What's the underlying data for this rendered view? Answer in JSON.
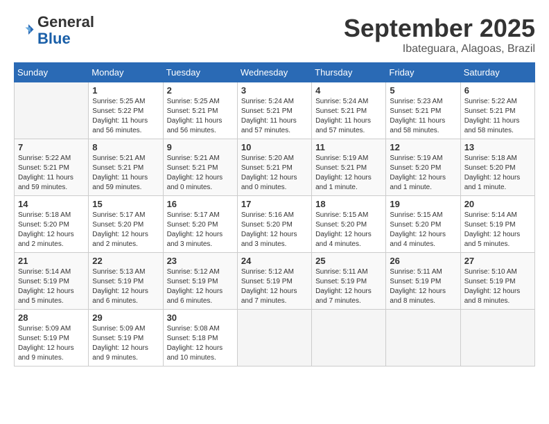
{
  "logo": {
    "text_general": "General",
    "text_blue": "Blue"
  },
  "title": "September 2025",
  "subtitle": "Ibateguara, Alagoas, Brazil",
  "weekdays": [
    "Sunday",
    "Monday",
    "Tuesday",
    "Wednesday",
    "Thursday",
    "Friday",
    "Saturday"
  ],
  "weeks": [
    [
      {
        "day": "",
        "empty": true
      },
      {
        "day": "1",
        "sunrise": "5:25 AM",
        "sunset": "5:22 PM",
        "daylight": "11 hours and 56 minutes."
      },
      {
        "day": "2",
        "sunrise": "5:25 AM",
        "sunset": "5:21 PM",
        "daylight": "11 hours and 56 minutes."
      },
      {
        "day": "3",
        "sunrise": "5:24 AM",
        "sunset": "5:21 PM",
        "daylight": "11 hours and 57 minutes."
      },
      {
        "day": "4",
        "sunrise": "5:24 AM",
        "sunset": "5:21 PM",
        "daylight": "11 hours and 57 minutes."
      },
      {
        "day": "5",
        "sunrise": "5:23 AM",
        "sunset": "5:21 PM",
        "daylight": "11 hours and 58 minutes."
      },
      {
        "day": "6",
        "sunrise": "5:22 AM",
        "sunset": "5:21 PM",
        "daylight": "11 hours and 58 minutes."
      }
    ],
    [
      {
        "day": "7",
        "sunrise": "5:22 AM",
        "sunset": "5:21 PM",
        "daylight": "11 hours and 59 minutes."
      },
      {
        "day": "8",
        "sunrise": "5:21 AM",
        "sunset": "5:21 PM",
        "daylight": "11 hours and 59 minutes."
      },
      {
        "day": "9",
        "sunrise": "5:21 AM",
        "sunset": "5:21 PM",
        "daylight": "12 hours and 0 minutes."
      },
      {
        "day": "10",
        "sunrise": "5:20 AM",
        "sunset": "5:21 PM",
        "daylight": "12 hours and 0 minutes."
      },
      {
        "day": "11",
        "sunrise": "5:19 AM",
        "sunset": "5:21 PM",
        "daylight": "12 hours and 1 minute."
      },
      {
        "day": "12",
        "sunrise": "5:19 AM",
        "sunset": "5:20 PM",
        "daylight": "12 hours and 1 minute."
      },
      {
        "day": "13",
        "sunrise": "5:18 AM",
        "sunset": "5:20 PM",
        "daylight": "12 hours and 1 minute."
      }
    ],
    [
      {
        "day": "14",
        "sunrise": "5:18 AM",
        "sunset": "5:20 PM",
        "daylight": "12 hours and 2 minutes."
      },
      {
        "day": "15",
        "sunrise": "5:17 AM",
        "sunset": "5:20 PM",
        "daylight": "12 hours and 2 minutes."
      },
      {
        "day": "16",
        "sunrise": "5:17 AM",
        "sunset": "5:20 PM",
        "daylight": "12 hours and 3 minutes."
      },
      {
        "day": "17",
        "sunrise": "5:16 AM",
        "sunset": "5:20 PM",
        "daylight": "12 hours and 3 minutes."
      },
      {
        "day": "18",
        "sunrise": "5:15 AM",
        "sunset": "5:20 PM",
        "daylight": "12 hours and 4 minutes."
      },
      {
        "day": "19",
        "sunrise": "5:15 AM",
        "sunset": "5:20 PM",
        "daylight": "12 hours and 4 minutes."
      },
      {
        "day": "20",
        "sunrise": "5:14 AM",
        "sunset": "5:19 PM",
        "daylight": "12 hours and 5 minutes."
      }
    ],
    [
      {
        "day": "21",
        "sunrise": "5:14 AM",
        "sunset": "5:19 PM",
        "daylight": "12 hours and 5 minutes."
      },
      {
        "day": "22",
        "sunrise": "5:13 AM",
        "sunset": "5:19 PM",
        "daylight": "12 hours and 6 minutes."
      },
      {
        "day": "23",
        "sunrise": "5:12 AM",
        "sunset": "5:19 PM",
        "daylight": "12 hours and 6 minutes."
      },
      {
        "day": "24",
        "sunrise": "5:12 AM",
        "sunset": "5:19 PM",
        "daylight": "12 hours and 7 minutes."
      },
      {
        "day": "25",
        "sunrise": "5:11 AM",
        "sunset": "5:19 PM",
        "daylight": "12 hours and 7 minutes."
      },
      {
        "day": "26",
        "sunrise": "5:11 AM",
        "sunset": "5:19 PM",
        "daylight": "12 hours and 8 minutes."
      },
      {
        "day": "27",
        "sunrise": "5:10 AM",
        "sunset": "5:19 PM",
        "daylight": "12 hours and 8 minutes."
      }
    ],
    [
      {
        "day": "28",
        "sunrise": "5:09 AM",
        "sunset": "5:19 PM",
        "daylight": "12 hours and 9 minutes."
      },
      {
        "day": "29",
        "sunrise": "5:09 AM",
        "sunset": "5:19 PM",
        "daylight": "12 hours and 9 minutes."
      },
      {
        "day": "30",
        "sunrise": "5:08 AM",
        "sunset": "5:18 PM",
        "daylight": "12 hours and 10 minutes."
      },
      {
        "day": "",
        "empty": true
      },
      {
        "day": "",
        "empty": true
      },
      {
        "day": "",
        "empty": true
      },
      {
        "day": "",
        "empty": true
      }
    ]
  ]
}
